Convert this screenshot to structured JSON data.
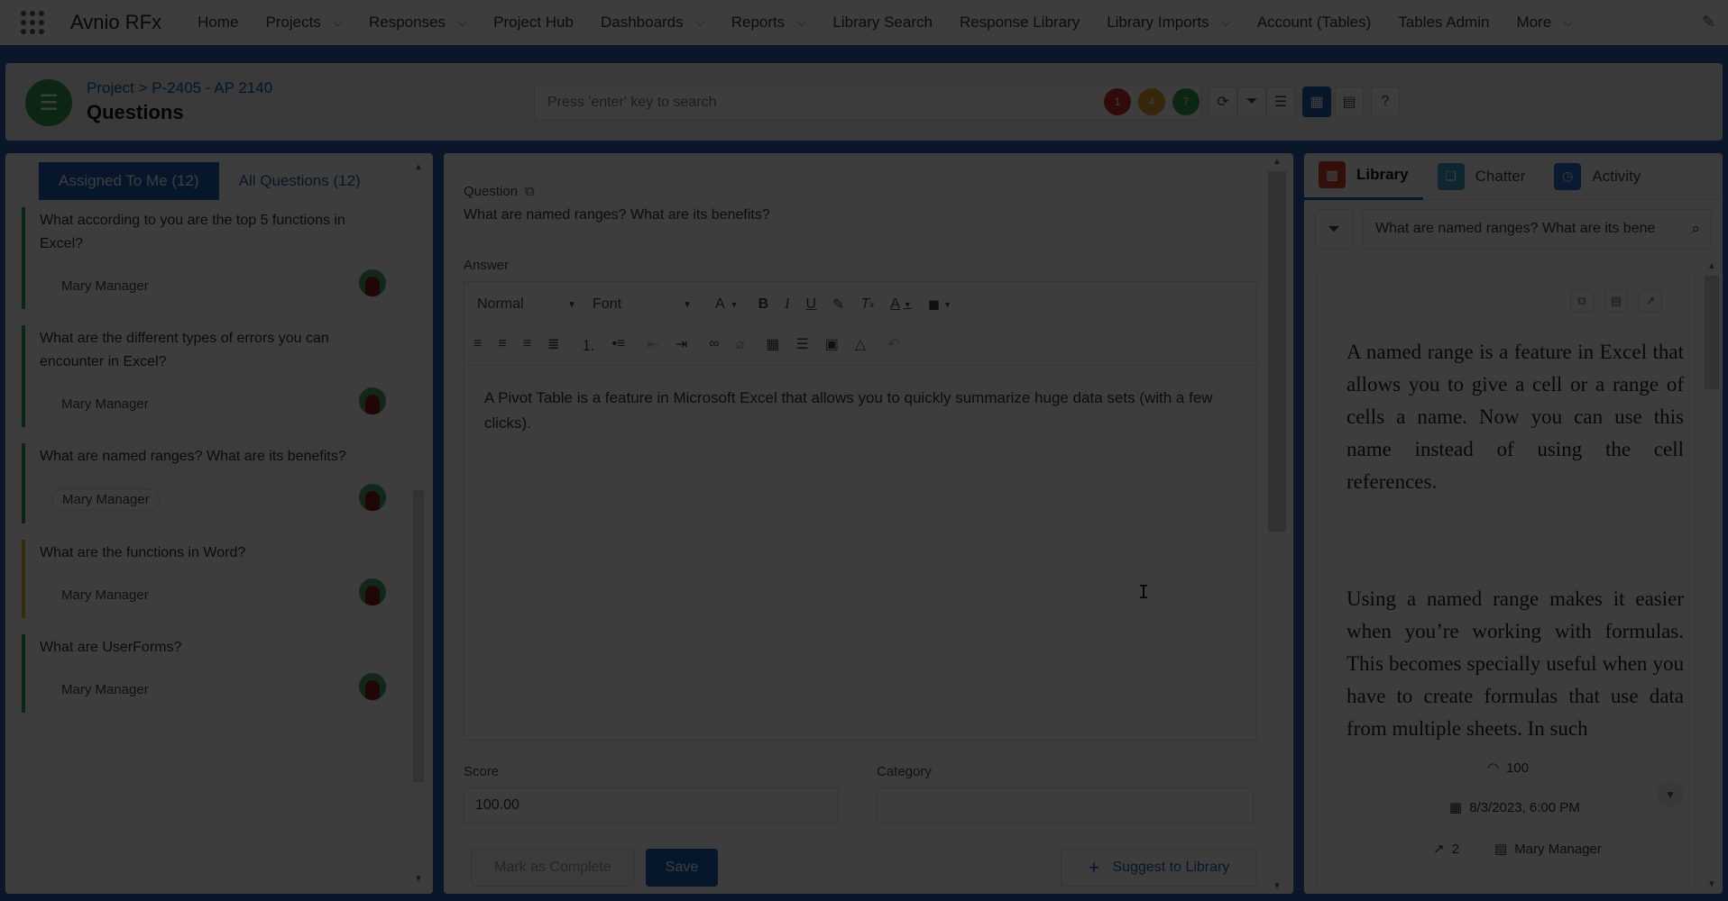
{
  "app": {
    "name": "Avnio RFx"
  },
  "nav": {
    "items": [
      {
        "label": "Home",
        "dropdown": false
      },
      {
        "label": "Projects",
        "dropdown": true
      },
      {
        "label": "Responses",
        "dropdown": true
      },
      {
        "label": "Project Hub",
        "dropdown": false
      },
      {
        "label": "Dashboards",
        "dropdown": true
      },
      {
        "label": "Reports",
        "dropdown": true
      },
      {
        "label": "Library Search",
        "dropdown": false
      },
      {
        "label": "Response Library",
        "dropdown": false
      },
      {
        "label": "Library Imports",
        "dropdown": true
      },
      {
        "label": "Account (Tables)",
        "dropdown": false
      },
      {
        "label": "Tables Admin",
        "dropdown": false
      },
      {
        "label": "More",
        "dropdown": true
      }
    ]
  },
  "header": {
    "breadcrumb": "Project > P-2405 - AP 2140",
    "title": "Questions",
    "search_placeholder": "Press 'enter' key to search",
    "status_badges": [
      {
        "count": "1",
        "color": "#d22a2a"
      },
      {
        "count": "4",
        "color": "#e3a02a"
      },
      {
        "count": "7",
        "color": "#2e9d4c"
      }
    ]
  },
  "left": {
    "tabs": [
      {
        "label": "Assigned To Me (12)",
        "active": true
      },
      {
        "label": "All Questions (12)",
        "active": false
      }
    ],
    "questions": [
      {
        "text": "What according to you are the top 5 functions in Excel?",
        "owner": "Mary Manager",
        "status": "green",
        "selected": false
      },
      {
        "text": "What are the different types of errors you can encounter in Excel?",
        "owner": "Mary Manager",
        "status": "green",
        "selected": false
      },
      {
        "text": "What are named ranges? What are its benefits?",
        "owner": "Mary Manager",
        "status": "green",
        "selected": true
      },
      {
        "text": "What are the functions in Word?",
        "owner": "Mary Manager",
        "status": "yellow",
        "selected": false
      },
      {
        "text": "What are UserForms?",
        "owner": "Mary Manager",
        "status": "green",
        "selected": false
      }
    ]
  },
  "center": {
    "question_label": "Question",
    "question_text": "What are named ranges? What are its benefits?",
    "answer_label": "Answer",
    "toolbar": {
      "format_select": "Normal",
      "font_select": "Font"
    },
    "answer_text": "A Pivot Table is a feature in Microsoft Excel that allows you to quickly summarize huge data sets (with a few clicks).",
    "score_label": "Score",
    "score_value": "100.00",
    "category_label": "Category",
    "category_value": "",
    "mark_complete_label": "Mark as Complete",
    "save_label": "Save",
    "suggest_label": "Suggest to Library"
  },
  "right": {
    "tabs": [
      {
        "label": "Library",
        "active": true,
        "icon_color": "#d9402a"
      },
      {
        "label": "Chatter",
        "active": false,
        "icon_color": "#3ba3c9"
      },
      {
        "label": "Activity",
        "active": false,
        "icon_color": "#2d6fd1"
      }
    ],
    "search_value": "What are named ranges? What are its bene",
    "library_paragraph_1": "A named range is a feature in Excel that allows you to give a cell or a range of cells a name. Now you can use this name instead of using the cell references.",
    "library_paragraph_2": "Using a named range makes it easier when you’re working with formulas. This becomes specially useful when you have to create formulas that use data from multiple sheets. In such",
    "score": "100",
    "date": "8/3/2023, 6:00 PM",
    "usage_count": "2",
    "author": "Mary Manager"
  },
  "colors": {
    "brand_blue": "#1e5fb5",
    "status_green": "#2e9d4c",
    "status_yellow": "#e3b32a",
    "status_red": "#d22a2a"
  }
}
